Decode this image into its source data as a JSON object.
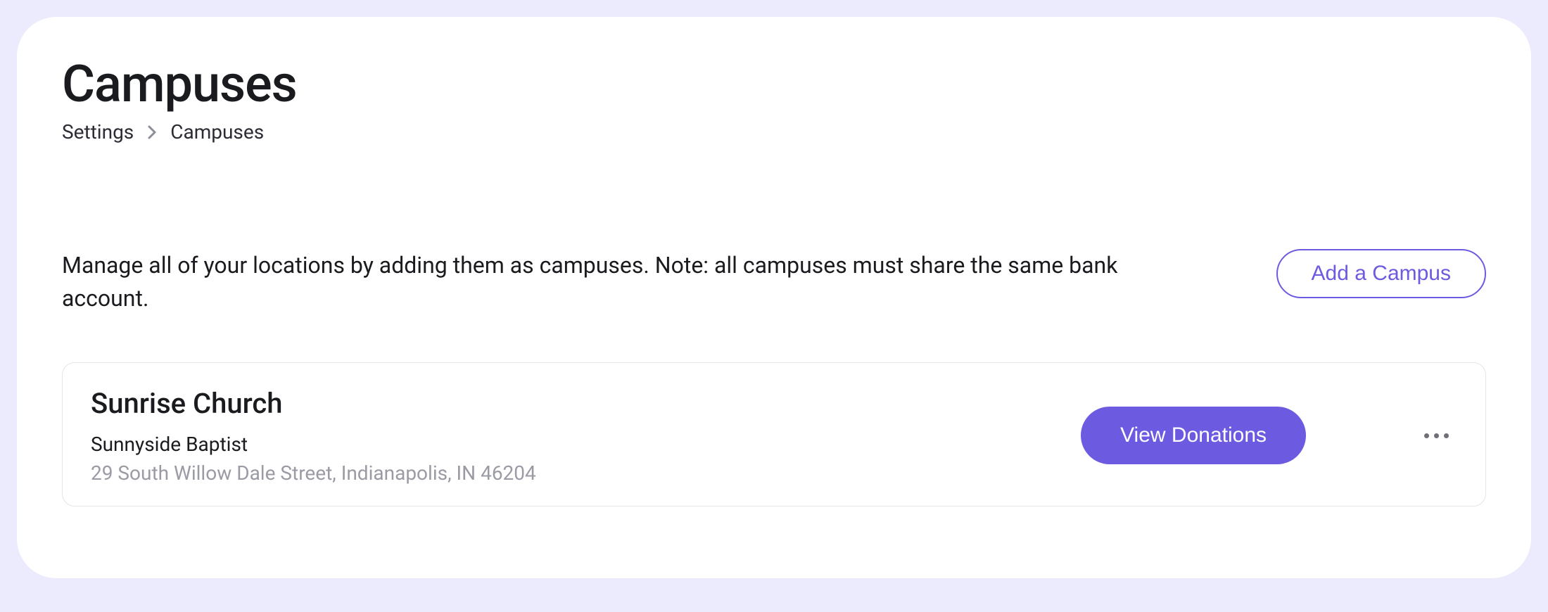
{
  "page": {
    "title": "Campuses",
    "breadcrumb": {
      "root": "Settings",
      "current": "Campuses"
    },
    "description": "Manage all of your locations by adding them as campuses. Note: all campuses must share the same bank account.",
    "add_button_label": "Add a Campus"
  },
  "campuses": [
    {
      "name": "Sunrise Church",
      "org": "Sunnyside Baptist",
      "address": "29 South Willow Dale Street, Indianapolis, IN 46204",
      "view_donations_label": "View Donations"
    }
  ]
}
